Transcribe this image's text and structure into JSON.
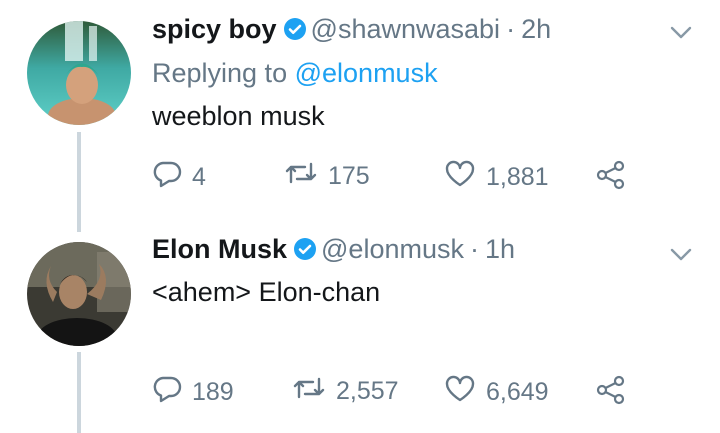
{
  "tweets": [
    {
      "name": "spicy boy",
      "handle": "@shawnwasabi",
      "separator": "·",
      "time": "2h",
      "replying_prefix": "Replying to",
      "replying_to": "@elonmusk",
      "text": "weeblon musk",
      "replies": "4",
      "retweets": "175",
      "likes": "1,881"
    },
    {
      "name": "Elon Musk",
      "handle": "@elonmusk",
      "separator": "·",
      "time": "1h",
      "text": "<ahem> Elon-chan",
      "replies": "189",
      "retweets": "2,557",
      "likes": "6,649"
    }
  ],
  "colors": {
    "text": "#14171a",
    "muted": "#657786",
    "link": "#1da1f2",
    "thread_line": "#ccd6dd"
  },
  "icons": [
    "verified-badge-icon",
    "chevron-down-icon",
    "reply-icon",
    "retweet-icon",
    "like-icon",
    "share-icon"
  ]
}
